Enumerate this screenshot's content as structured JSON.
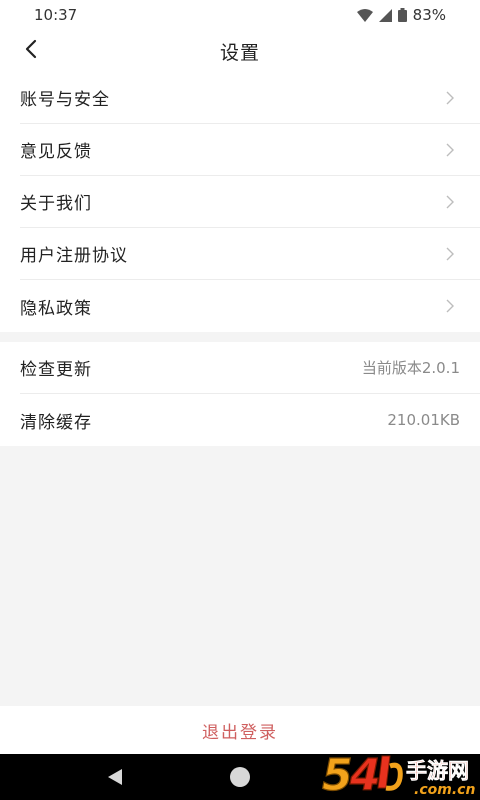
{
  "status_bar": {
    "time": "10:37",
    "battery": "83%",
    "icons": [
      "wifi-icon",
      "signal-icon",
      "battery-icon"
    ]
  },
  "header": {
    "title": "设置",
    "back_icon": "chevron-left-icon"
  },
  "settings_group_1": [
    {
      "label": "账号与安全"
    },
    {
      "label": "意见反馈"
    },
    {
      "label": "关于我们"
    },
    {
      "label": "用户注册协议"
    },
    {
      "label": "隐私政策"
    }
  ],
  "settings_group_2": [
    {
      "label": "检查更新",
      "value": "当前版本2.0.1"
    },
    {
      "label": "清除缓存",
      "value": "210.01KB"
    }
  ],
  "logout": {
    "label": "退出登录"
  },
  "watermark": {
    "number": "54",
    "brand": "手游网",
    "domain": ".com.cn"
  },
  "colors": {
    "logout": "#cf5f5f",
    "background": "#f4f4f4",
    "watermark_orange": "#f2a21b",
    "watermark_red": "#e8321e"
  }
}
